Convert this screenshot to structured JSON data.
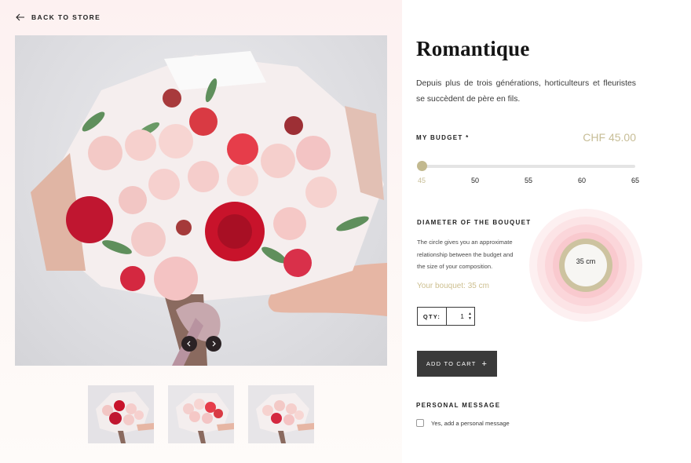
{
  "nav": {
    "back_label": "BACK TO STORE",
    "back_icon": "arrow-left-icon"
  },
  "product": {
    "title": "Romantique",
    "description": "Depuis plus de trois générations, horticulteurs et fleuristes se succèdent de père en fils.",
    "image_count": 3
  },
  "budget": {
    "label": "MY BUDGET *",
    "price": "CHF 45.00",
    "value": 45,
    "min": 45,
    "max": 65,
    "ticks": [
      "45",
      "50",
      "55",
      "60",
      "65"
    ],
    "accent_color": "#c2b98f"
  },
  "diameter": {
    "label": "DIAMETER OF THE BOUQUET",
    "text": "The circle gives you an approximate relationship between the budget and the size of your composition.",
    "your_bouquet": "Your bouquet: 35 cm",
    "circle_label": "35 cm"
  },
  "qty": {
    "label": "QTY:",
    "value": "1"
  },
  "cart": {
    "label": "ADD TO CART",
    "plus": "+",
    "button_color": "#3a3a3a"
  },
  "personal": {
    "label": "PERSONAL MESSAGE",
    "checkbox_label": "Yes, add a personal message",
    "checked": false
  },
  "gallery": {
    "prev_icon": "chevron-left-icon",
    "next_icon": "chevron-right-icon"
  }
}
